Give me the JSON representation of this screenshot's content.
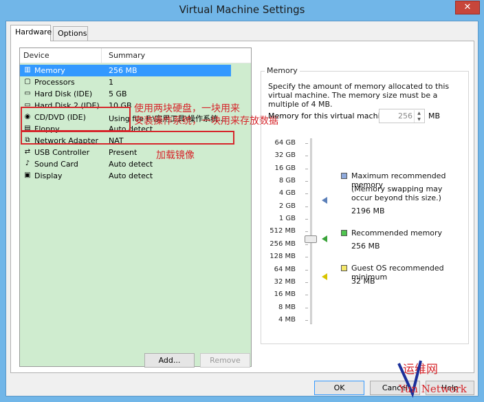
{
  "window": {
    "title": "Virtual Machine Settings",
    "close_glyph": "✕"
  },
  "tabs": [
    {
      "label": "Hardware"
    },
    {
      "label": "Options"
    }
  ],
  "device_list": {
    "col_device": "Device",
    "col_summary": "Summary",
    "items": [
      {
        "name": "Memory",
        "summary": "256 MB",
        "icon": "memory-icon"
      },
      {
        "name": "Processors",
        "summary": "1",
        "icon": "processor-icon"
      },
      {
        "name": "Hard Disk (IDE)",
        "summary": "5 GB",
        "icon": "hard-disk-icon"
      },
      {
        "name": "Hard Disk 2 (IDE)",
        "summary": "10 GB",
        "icon": "hard-disk-icon"
      },
      {
        "name": "CD/DVD (IDE)",
        "summary": "Using file F:\\实用工具\\操作系统...",
        "icon": "cd-dvd-icon"
      },
      {
        "name": "Floppy",
        "summary": "Auto detect",
        "icon": "floppy-icon"
      },
      {
        "name": "Network Adapter",
        "summary": "NAT",
        "icon": "network-icon"
      },
      {
        "name": "USB Controller",
        "summary": "Present",
        "icon": "usb-icon"
      },
      {
        "name": "Sound Card",
        "summary": "Auto detect",
        "icon": "sound-icon"
      },
      {
        "name": "Display",
        "summary": "Auto detect",
        "icon": "display-icon"
      }
    ],
    "selected_index": 0
  },
  "annotations": {
    "disks_line1": "使用两块硬盘，一块用来",
    "disks_line2": "安装操作系统，一块用来存放数据",
    "cd_note": "加载镜像"
  },
  "buttons": {
    "add": "Add...",
    "remove": "Remove",
    "ok": "OK",
    "cancel": "Cancel",
    "help": "Help"
  },
  "memory": {
    "legend": "Memory",
    "description": "Specify the amount of memory allocated to this virtual machine. The memory size must be a multiple of 4 MB.",
    "field_label": "Memory for this virtual machine:",
    "value": "256",
    "unit": "MB",
    "scale": [
      "64 GB",
      "32 GB",
      "16 GB",
      "8 GB",
      "4 GB",
      "2 GB",
      "1 GB",
      "512 MB",
      "256 MB",
      "128 MB",
      "64 MB",
      "32 MB",
      "16 MB",
      "8 MB",
      "4 MB"
    ],
    "max_recommended": {
      "title": "Maximum recommended memory",
      "note": "(Memory swapping may occur beyond this size.)",
      "value": "2196 MB",
      "color": "#8faadc"
    },
    "recommended": {
      "title": "Recommended memory",
      "value": "256 MB",
      "color": "#4fc44f"
    },
    "guest_min": {
      "title": "Guest OS recommended minimum",
      "value": "32 MB",
      "color": "#f5e86a"
    }
  },
  "watermark": {
    "line1": "运维网",
    "line2": "Yun Network"
  }
}
